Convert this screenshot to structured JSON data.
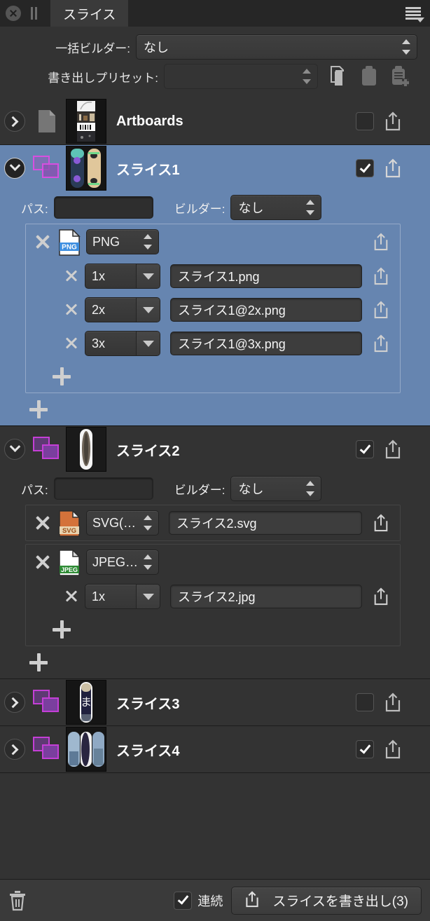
{
  "window": {
    "tab_label": "スライス",
    "close_icon": "close-circle-icon",
    "pause_icon": "pause-icon",
    "menu_icon": "panel-menu-icon"
  },
  "header": {
    "batch_builder_label": "一括ビルダー:",
    "batch_builder_value": "なし",
    "export_preset_label": "書き出しプリセット:",
    "export_preset_value": "",
    "icons": [
      "copy-icon",
      "paste-icon",
      "paste-add-icon"
    ]
  },
  "colors": {
    "selection": "#6685b0",
    "panel_bg": "#333333",
    "titlebar_bg": "#262626",
    "slice_icon": "#b64fd0"
  },
  "rows": [
    {
      "name": "Artboards",
      "expanded": false,
      "chevron": "chevron-right-icon",
      "type_icon": "document-icon",
      "checked": false,
      "share_icon": "share-icon"
    },
    {
      "name": "スライス1",
      "expanded": true,
      "chevron": "chevron-down-icon",
      "type_icon": "slice-icon",
      "checked": true,
      "share_icon": "share-icon",
      "path_label": "パス:",
      "path_value": "",
      "builder_label": "ビルダー:",
      "builder_value": "なし",
      "formats": [
        {
          "file_icon": "png-file-icon",
          "format": "PNG",
          "scales": [
            {
              "scale": "1x",
              "filename": "スライス1.png"
            },
            {
              "scale": "2x",
              "filename": "スライス1@2x.png"
            },
            {
              "scale": "3x",
              "filename": "スライス1@3x.png"
            }
          ]
        }
      ],
      "add_scale_label": "+",
      "add_format_label": "+"
    },
    {
      "name": "スライス2",
      "expanded": true,
      "chevron": "chevron-down-icon",
      "type_icon": "slice-icon",
      "checked": true,
      "share_icon": "share-icon",
      "path_label": "パス:",
      "path_value": "",
      "builder_label": "ビルダー:",
      "builder_value": "なし",
      "formats": [
        {
          "file_icon": "svg-file-icon",
          "format": "SVG(…",
          "filename": "スライス2.svg",
          "scales": []
        },
        {
          "file_icon": "jpeg-file-icon",
          "format": "JPEG…",
          "scales": [
            {
              "scale": "1x",
              "filename": "スライス2.jpg"
            }
          ]
        }
      ],
      "add_scale_label": "+",
      "add_format_label": "+"
    },
    {
      "name": "スライス3",
      "expanded": false,
      "chevron": "chevron-right-icon",
      "type_icon": "slice-icon",
      "checked": false,
      "share_icon": "share-icon"
    },
    {
      "name": "スライス4",
      "expanded": false,
      "chevron": "chevron-right-icon",
      "type_icon": "slice-icon",
      "checked": true,
      "share_icon": "share-icon"
    }
  ],
  "footer": {
    "trash_icon": "trash-icon",
    "continuous_label": "連続",
    "continuous_checked": true,
    "export_button_label": "スライスを書き出し(3)",
    "export_button_icon": "share-icon"
  }
}
